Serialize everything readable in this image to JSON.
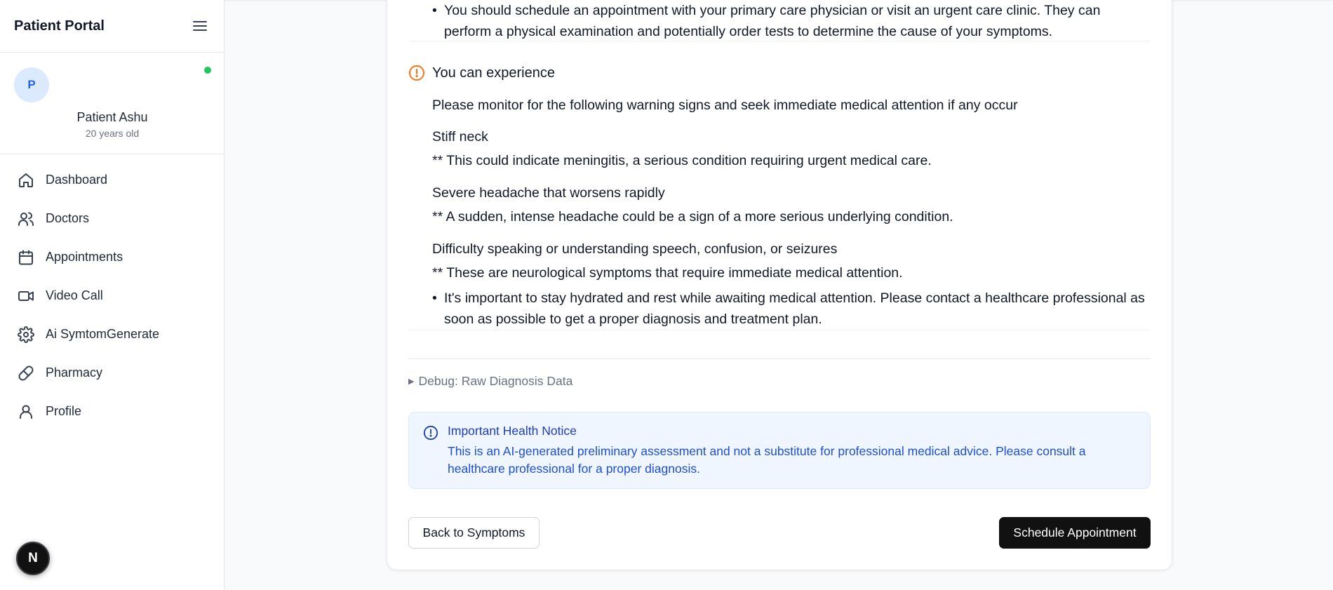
{
  "sidebar": {
    "title": "Patient Portal",
    "user": {
      "initial": "P",
      "name": "Patient Ashu",
      "age": "20 years old"
    },
    "items": [
      {
        "label": "Dashboard",
        "icon": "home-icon"
      },
      {
        "label": "Doctors",
        "icon": "users-icon"
      },
      {
        "label": "Appointments",
        "icon": "calendar-icon"
      },
      {
        "label": "Video Call",
        "icon": "video-icon"
      },
      {
        "label": "Ai SymtomGenerate",
        "icon": "gear-icon"
      },
      {
        "label": "Pharmacy",
        "icon": "pill-icon"
      },
      {
        "label": "Profile",
        "icon": "user-icon"
      }
    ],
    "badge": "N"
  },
  "diagnosis": {
    "top_bullet": "You should schedule an appointment with your primary care physician or visit an urgent care clinic. They can perform a physical examination and potentially order tests to determine the cause of your symptoms.",
    "warning_heading": "You can experience",
    "warning_intro": "Please monitor for the following warning signs and seek immediate medical attention if any occur",
    "signs": [
      {
        "title": "Stiff neck",
        "note": "** This could indicate meningitis, a serious condition requiring urgent medical care."
      },
      {
        "title": "Severe headache that worsens rapidly",
        "note": "** A sudden, intense headache could be a sign of a more serious underlying condition."
      },
      {
        "title": "Difficulty speaking or understanding speech, confusion, or seizures",
        "note": "** These are neurological symptoms that require immediate medical attention."
      }
    ],
    "final_bullet": "It's important to stay hydrated and rest while awaiting medical attention. Please contact a healthcare professional as soon as possible to get a proper diagnosis and treatment plan.",
    "debug_label": "Debug: Raw Diagnosis Data"
  },
  "notice": {
    "title": "Important Health Notice",
    "message": "This is an AI-generated preliminary assessment and not a substitute for professional medical advice. Please consult a healthcare professional for a proper diagnosis."
  },
  "actions": {
    "back_label": "Back to Symptoms",
    "schedule_label": "Schedule Appointment"
  },
  "colors": {
    "warning": "#f97316",
    "notice_bg": "#eff6ff",
    "notice_text": "#1d4ed8",
    "online": "#22c55e",
    "primary_button": "#111111"
  }
}
